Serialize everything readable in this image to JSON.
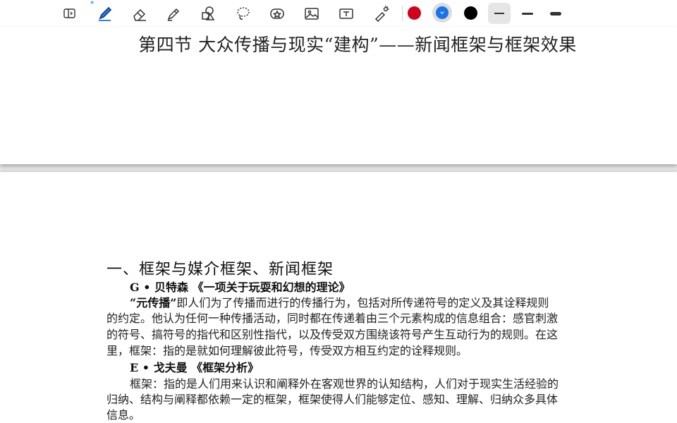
{
  "toolbar": {
    "bluetooth_mark": "*",
    "tools": [
      "page-toggle",
      "pen",
      "eraser",
      "highlighter",
      "shapes",
      "lasso",
      "sticker",
      "image",
      "text",
      "laser-pointer"
    ],
    "colors": [
      "#d0021b",
      "#1a73e8",
      "#000000"
    ],
    "selected_color": "#1a73e8",
    "accent": "#1b6fe0"
  },
  "page1": {
    "title": "第四节 大众传播与现实“建构”——新闻框架与框架效果"
  },
  "page2": {
    "heading": "一、框架与媒介框架、新闻框架",
    "ref1": "G • 贝特森 《一项关于玩耍和幻想的理论》",
    "p1_term": "“元传播”",
    "p1_line1": "即人们为了传播而进行的传播行为，包括对所传递符号的定义及其诠释规则",
    "p1_line2": "的约定。他认为任何一种传播活动，同时都在传递着由三个元素构成的信息组合：感官刺激",
    "p1_line3": "的符号、搞符号的指代和区别性指代，以及传受双方围绕该符号产生互动行为的规则。在这",
    "p1_line4": "里，框架：指的是就如何理解彼此符号，传受双方相互约定的诠释规则。",
    "ref2": "E • 戈夫曼 《框架分析》",
    "p2_line1": "框架：指的是人们用来认识和阐释外在客观世界的认知结构，人们对于现实生活经验的",
    "p2_line2": "归纳、结构与阐释都依赖一定的框架，框架使得人们能够定位、感知、理解、归纳众多具体",
    "p2_line3": "信息。"
  }
}
